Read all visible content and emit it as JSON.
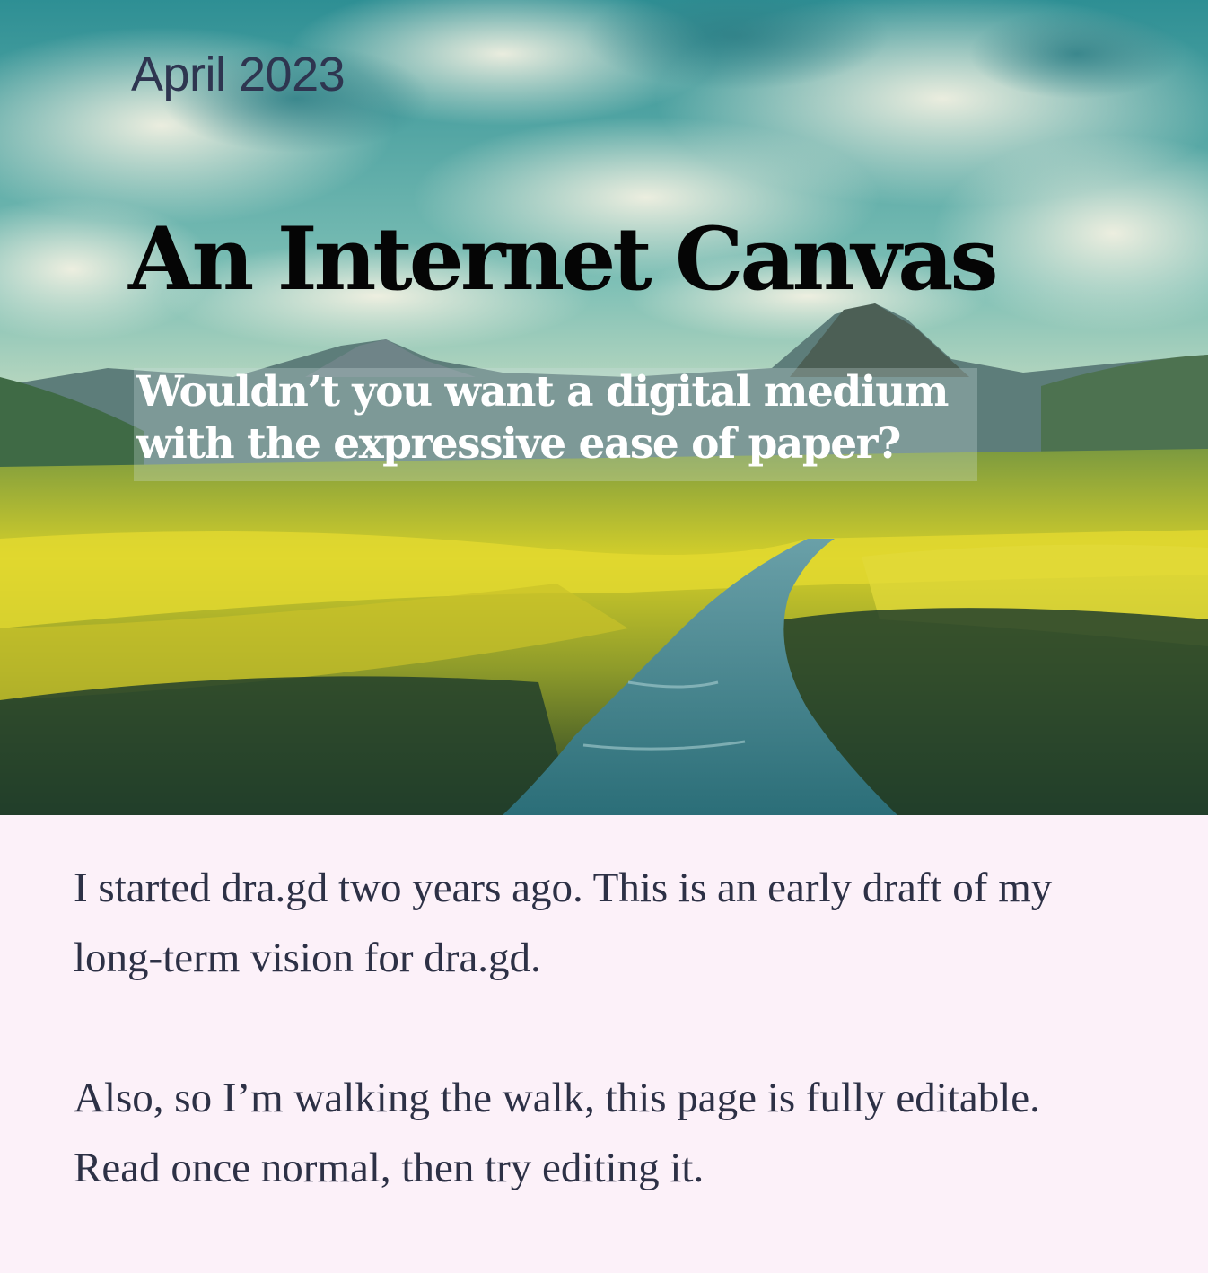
{
  "header": {
    "date": "April 2023",
    "title": "An Internet Canvas",
    "subtitle_line1": "Wouldn’t you want a digital medium",
    "subtitle_line2": "with the expressive ease of paper?"
  },
  "hero": {
    "image_icon": "landscape-illustration"
  },
  "body": {
    "paragraph1": "I started dra.gd two years ago. This is an early draft of my long-term vision for dra.gd.",
    "paragraph2": "Also, so I’m walking the walk, this page is fully editable. Read once normal, then try editing it."
  },
  "colors": {
    "page_background": "#fcf1f9",
    "body_text": "#2d3146",
    "title_text": "#050505",
    "subtitle_text": "#ffffff"
  }
}
